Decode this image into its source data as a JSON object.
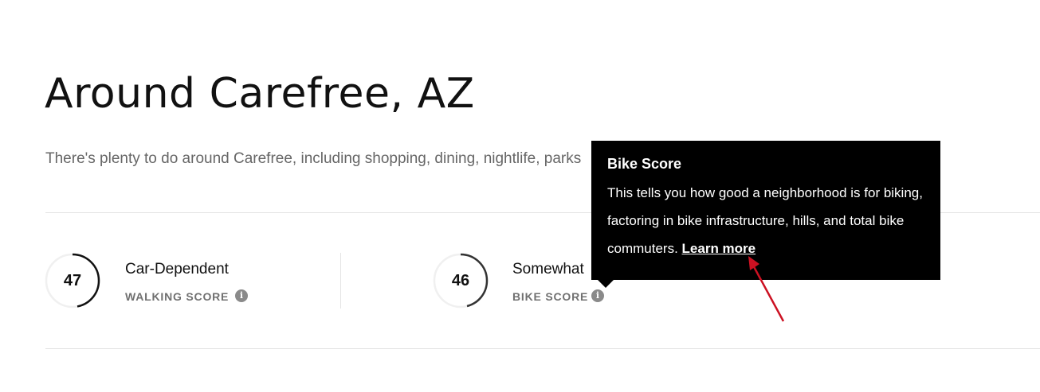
{
  "title": "Around Carefree, AZ",
  "subtitle": "There's plenty to do around Carefree, including shopping, dining, nightlife, parks",
  "scores": [
    {
      "value": "47",
      "label": "Car-Dependent",
      "type": "WALKING SCORE",
      "percent": 47,
      "info_icon": "info-icon"
    },
    {
      "value": "46",
      "label": "Somewhat",
      "type": "BIKE SCORE",
      "percent": 46,
      "info_icon": "info-icon"
    }
  ],
  "tooltip": {
    "title": "Bike Score",
    "body": "This tells you how good a neighborhood is for biking, factoring in bike infrastructure, hills, and total bike commuters.",
    "link": "Learn more"
  },
  "annotation": {
    "color": "#cc1122"
  },
  "colors": {
    "ring_track": "#f0f0f0",
    "ring_fill_walk": "#111111",
    "ring_fill_bike": "#333333"
  }
}
